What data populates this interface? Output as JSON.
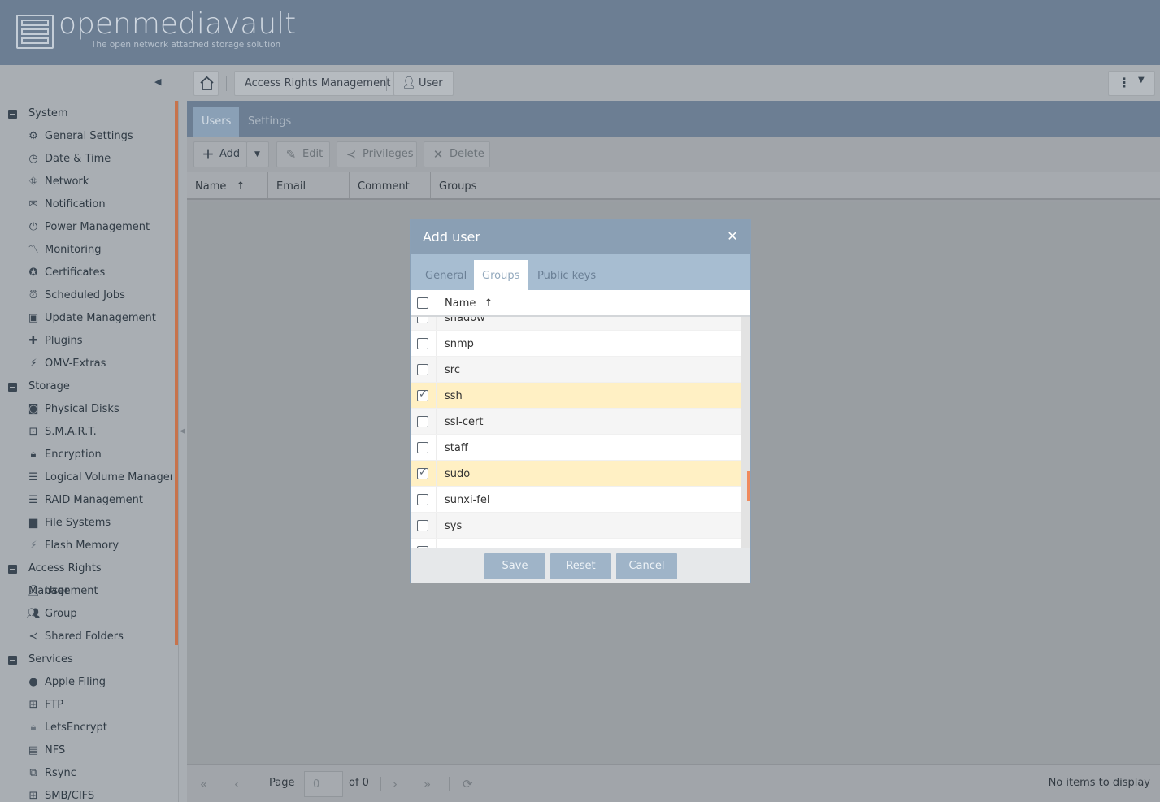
{
  "brand": {
    "name": "openmediavault",
    "tagline": "The open network attached storage solution"
  },
  "breadcrumbs": [
    "Access Rights Management",
    "User"
  ],
  "sidebar": {
    "groups": [
      {
        "label": "System",
        "items": [
          {
            "label": "General Settings",
            "icon": "gears-icon"
          },
          {
            "label": "Date & Time",
            "icon": "clock-icon"
          },
          {
            "label": "Network",
            "icon": "network-icon"
          },
          {
            "label": "Notification",
            "icon": "envelope-icon"
          },
          {
            "label": "Power Management",
            "icon": "power-icon"
          },
          {
            "label": "Monitoring",
            "icon": "chart-line-icon"
          },
          {
            "label": "Certificates",
            "icon": "certificate-icon"
          },
          {
            "label": "Scheduled Jobs",
            "icon": "alarm-clock-icon"
          },
          {
            "label": "Update Management",
            "icon": "archive-icon"
          },
          {
            "label": "Plugins",
            "icon": "puzzle-icon"
          },
          {
            "label": "OMV-Extras",
            "icon": "plug-icon"
          }
        ]
      },
      {
        "label": "Storage",
        "items": [
          {
            "label": "Physical Disks",
            "icon": "disk-icon"
          },
          {
            "label": "S.M.A.R.T.",
            "icon": "heartbeat-icon"
          },
          {
            "label": "Encryption",
            "icon": "lock-icon"
          },
          {
            "label": "Logical Volume Managem",
            "icon": "database-icon"
          },
          {
            "label": "RAID Management",
            "icon": "database-icon"
          },
          {
            "label": "File Systems",
            "icon": "folder-icon"
          },
          {
            "label": "Flash Memory",
            "icon": "bolt-icon"
          }
        ]
      },
      {
        "label": "Access Rights Management",
        "items": [
          {
            "label": "User",
            "icon": "user-icon"
          },
          {
            "label": "Group",
            "icon": "users-icon"
          },
          {
            "label": "Shared Folders",
            "icon": "share-icon"
          }
        ]
      },
      {
        "label": "Services",
        "items": [
          {
            "label": "Apple Filing",
            "icon": "apple-icon"
          },
          {
            "label": "FTP",
            "icon": "ftp-icon"
          },
          {
            "label": "LetsEncrypt",
            "icon": "lock-icon"
          },
          {
            "label": "NFS",
            "icon": "file-icon"
          },
          {
            "label": "Rsync",
            "icon": "sync-icon"
          },
          {
            "label": "SMB/CIFS",
            "icon": "windows-icon"
          }
        ]
      }
    ]
  },
  "main": {
    "tabs": [
      "Users",
      "Settings"
    ],
    "active_tab": "Users",
    "toolbar": {
      "add": "Add",
      "edit": "Edit",
      "privileges": "Privileges",
      "delete": "Delete"
    },
    "columns": [
      "Name",
      "Email",
      "Comment",
      "Groups"
    ],
    "pager": {
      "page_label": "Page",
      "page_value": "0",
      "of_label": "of 0",
      "status": "No items to display"
    }
  },
  "dialog": {
    "title": "Add user",
    "tabs": [
      "General",
      "Groups",
      "Public keys"
    ],
    "active_tab": "Groups",
    "column_header": "Name",
    "rows": [
      {
        "name": "shadow",
        "checked": false
      },
      {
        "name": "snmp",
        "checked": false
      },
      {
        "name": "src",
        "checked": false
      },
      {
        "name": "ssh",
        "checked": true
      },
      {
        "name": "ssl-cert",
        "checked": false
      },
      {
        "name": "staff",
        "checked": false
      },
      {
        "name": "sudo",
        "checked": true
      },
      {
        "name": "sunxi-fel",
        "checked": false
      },
      {
        "name": "sys",
        "checked": false
      }
    ],
    "buttons": {
      "save": "Save",
      "reset": "Reset",
      "cancel": "Cancel"
    }
  },
  "colors": {
    "header": "#6c7e93",
    "dialog_title": "#8a9fb4",
    "selected_row": "#fff0c4",
    "scroll_accent": "#f08a5d"
  }
}
